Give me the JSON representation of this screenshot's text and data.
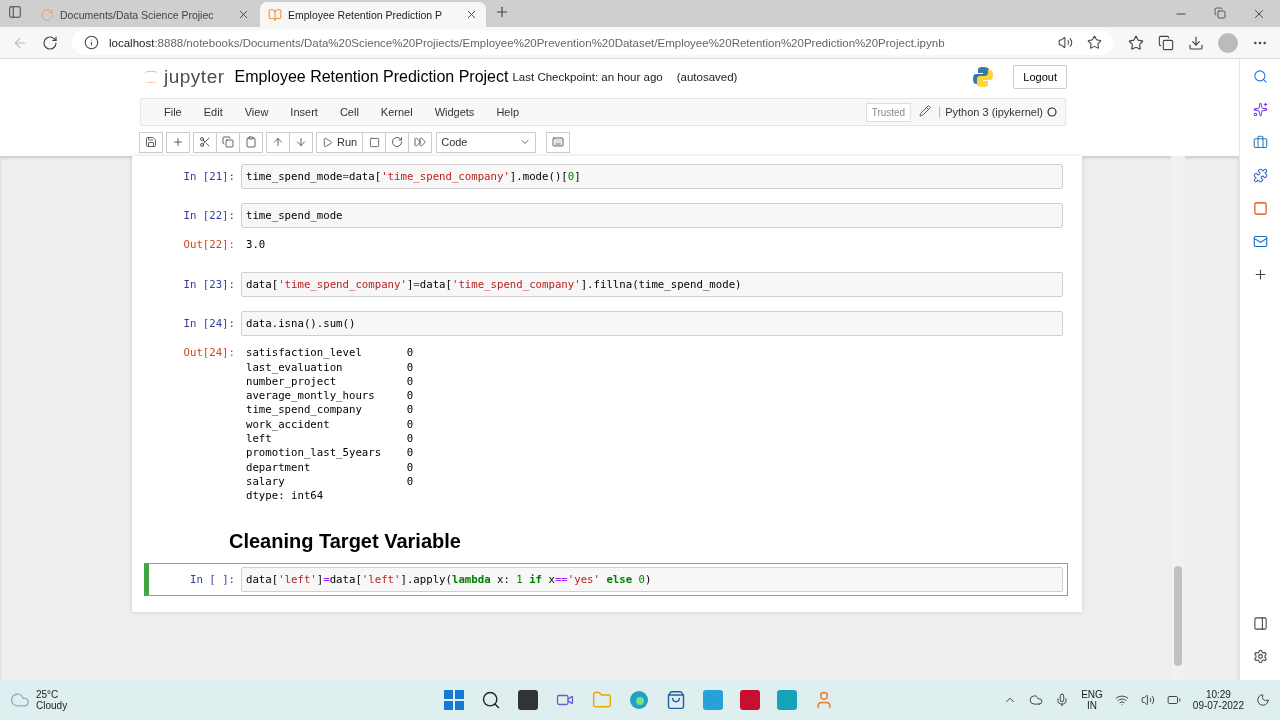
{
  "browser": {
    "tabs": [
      {
        "title": "Documents/Data Science Projiec",
        "selected": false
      },
      {
        "title": "Employee Retention Prediction P",
        "selected": true
      }
    ],
    "url_host": "localhost",
    "url_path": ":8888/notebooks/Documents/Data%20Science%20Projiects/Employee%20Prevention%20Dataset/Employee%20Retention%20Prediction%20Project.ipynb"
  },
  "notebook": {
    "logo": "jupyter",
    "title": "Employee Retention Prediction Project",
    "checkpoint": "Last Checkpoint: an hour ago",
    "autosaved": "(autosaved)",
    "logout": "Logout",
    "menu": [
      "File",
      "Edit",
      "View",
      "Insert",
      "Cell",
      "Kernel",
      "Widgets",
      "Help"
    ],
    "trusted": "Trusted",
    "kernel": "Python 3 (ipykernel)",
    "run": "Run",
    "cell_type": "Code"
  },
  "cells": [
    {
      "kind": "code",
      "prompt": "In [21]:",
      "selected": false,
      "tokens": [
        {
          "t": "time_spend_mode",
          "kind": "plain"
        },
        {
          "t": "=",
          "kind": "op"
        },
        {
          "t": "data[",
          "kind": "plain"
        },
        {
          "t": "'time_spend_company'",
          "kind": "string"
        },
        {
          "t": "].mode()[",
          "kind": "plain"
        },
        {
          "t": "0",
          "kind": "number"
        },
        {
          "t": "]",
          "kind": "plain"
        }
      ]
    },
    {
      "kind": "code",
      "prompt": "In [22]:",
      "selected": false,
      "tokens": [
        {
          "t": "time_spend_mode",
          "kind": "plain"
        }
      ],
      "output": {
        "prompt": "Out[22]:",
        "lines": [
          "3.0"
        ]
      }
    },
    {
      "kind": "code",
      "prompt": "In [23]:",
      "selected": false,
      "tokens": [
        {
          "t": "data[",
          "kind": "plain"
        },
        {
          "t": "'time_spend_company'",
          "kind": "string"
        },
        {
          "t": "]",
          "kind": "plain"
        },
        {
          "t": "=",
          "kind": "op"
        },
        {
          "t": "data[",
          "kind": "plain"
        },
        {
          "t": "'time_spend_company'",
          "kind": "string"
        },
        {
          "t": "].fillna(time_spend_mode)",
          "kind": "plain"
        }
      ]
    },
    {
      "kind": "code",
      "prompt": "In [24]:",
      "selected": false,
      "tokens": [
        {
          "t": "data.isna().sum()",
          "kind": "plain"
        }
      ],
      "output": {
        "prompt": "Out[24]:",
        "lines": [
          "satisfaction_level       0",
          "last_evaluation          0",
          "number_project           0",
          "average_montly_hours     0",
          "time_spend_company       0",
          "work_accident            0",
          "left                     0",
          "promotion_last_5years    0",
          "department               0",
          "salary                   0",
          "dtype: int64"
        ]
      }
    },
    {
      "kind": "markdown",
      "text": "Cleaning Target Variable"
    },
    {
      "kind": "code",
      "prompt": "In [ ]:",
      "selected": true,
      "tokens": [
        {
          "t": "data[",
          "kind": "plain"
        },
        {
          "t": "'left'",
          "kind": "string"
        },
        {
          "t": "]",
          "kind": "plain"
        },
        {
          "t": "=",
          "kind": "op"
        },
        {
          "t": "data[",
          "kind": "plain"
        },
        {
          "t": "'left'",
          "kind": "string"
        },
        {
          "t": "].apply(",
          "kind": "plain"
        },
        {
          "t": "lambda",
          "kind": "keyword"
        },
        {
          "t": " x: ",
          "kind": "plain"
        },
        {
          "t": "1",
          "kind": "number"
        },
        {
          "t": " if",
          "kind": "keyword"
        },
        {
          "t": " x",
          "kind": "plain"
        },
        {
          "t": "==",
          "kind": "op"
        },
        {
          "t": "'yes'",
          "kind": "string"
        },
        {
          "t": " else",
          "kind": "keyword"
        },
        {
          "t": " 0",
          "kind": "number"
        },
        {
          "t": ")",
          "kind": "plain"
        }
      ]
    }
  ],
  "taskbar": {
    "temperature": "25°C",
    "weather": "Cloudy",
    "lang": "ENG",
    "region": "IN",
    "time": "10:29",
    "date": "09-07-2022"
  }
}
